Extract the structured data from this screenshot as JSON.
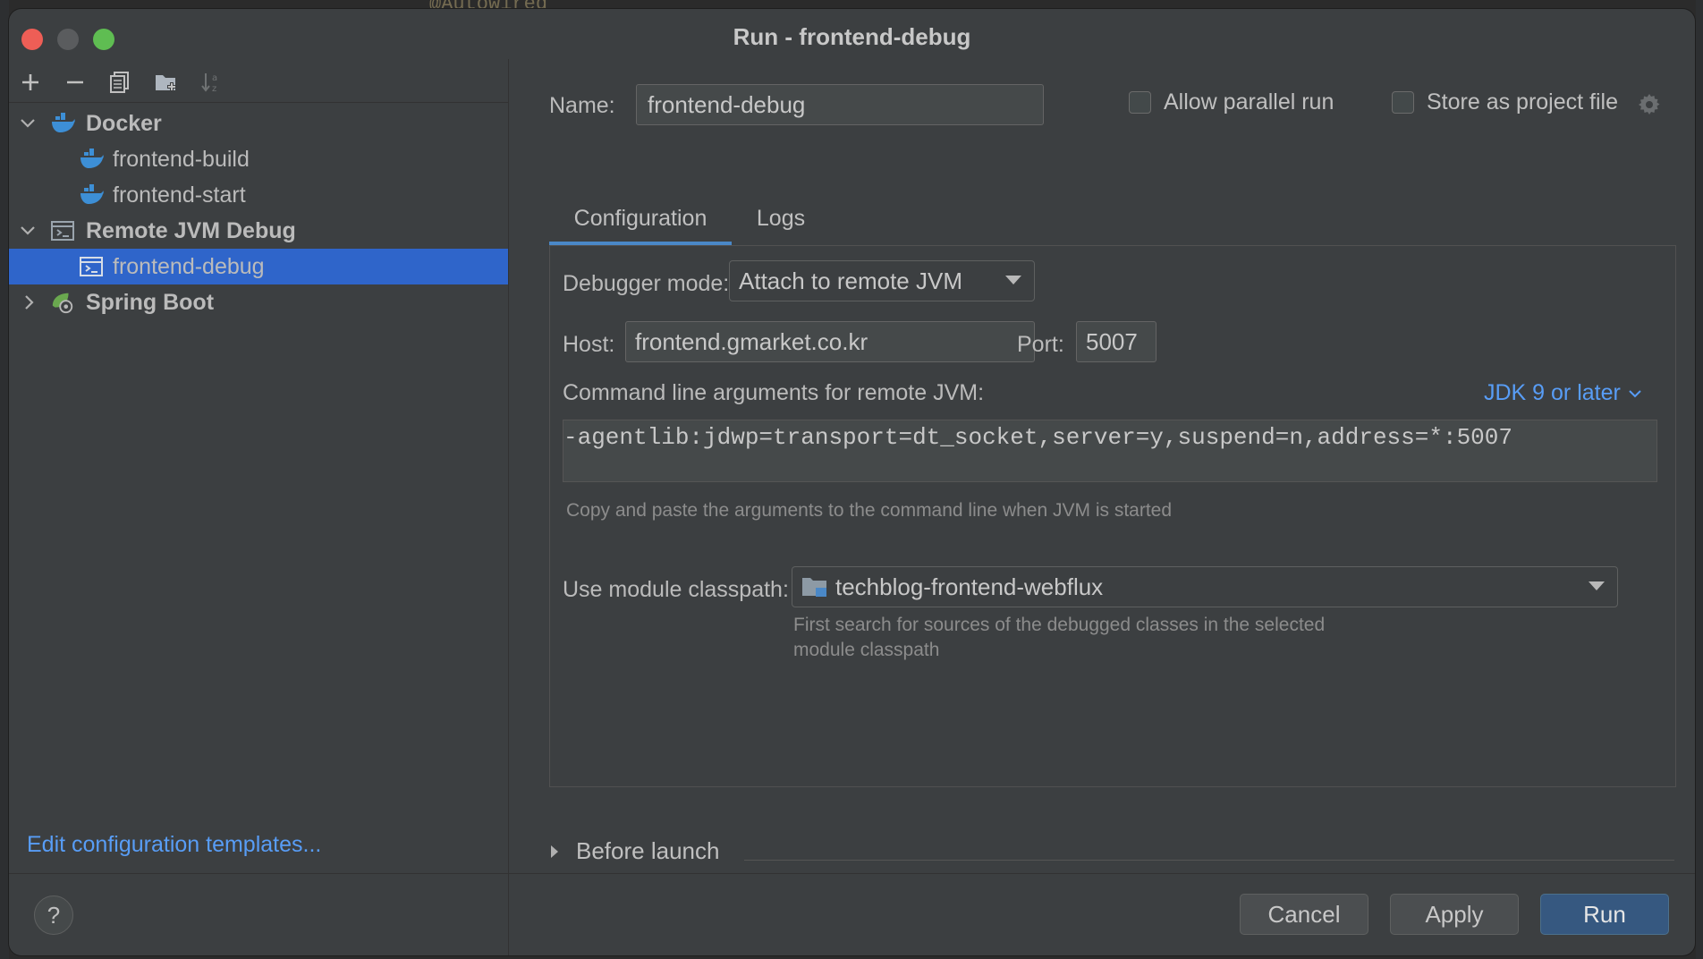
{
  "window": {
    "title": "Run - frontend-debug"
  },
  "background": {
    "code_fragment": "@Autowired"
  },
  "toolbar": {
    "icons": [
      "add-icon",
      "remove-icon",
      "copy-icon",
      "new-folder-icon",
      "sort-icon"
    ]
  },
  "tree": {
    "groups": [
      {
        "label": "Docker",
        "icon": "docker-icon",
        "expanded": true,
        "children": [
          {
            "label": "frontend-build",
            "icon": "docker-icon"
          },
          {
            "label": "frontend-start",
            "icon": "docker-icon"
          }
        ]
      },
      {
        "label": "Remote JVM Debug",
        "icon": "remote-debug-icon",
        "expanded": true,
        "children": [
          {
            "label": "frontend-debug",
            "icon": "remote-debug-icon",
            "selected": true
          }
        ]
      },
      {
        "label": "Spring Boot",
        "icon": "spring-boot-icon",
        "expanded": false,
        "children": []
      }
    ]
  },
  "edit_templates_link": "Edit configuration templates...",
  "form": {
    "name_label": "Name:",
    "name_value": "frontend-debug",
    "allow_parallel_label": "Allow parallel run",
    "allow_parallel_checked": false,
    "store_project_label": "Store as project file",
    "store_project_checked": false
  },
  "tabs": [
    {
      "label": "Configuration",
      "active": true
    },
    {
      "label": "Logs",
      "active": false
    }
  ],
  "config": {
    "debugger_mode_label": "Debugger mode:",
    "debugger_mode_value": "Attach to remote JVM",
    "host_label": "Host:",
    "host_value": "frontend.gmarket.co.kr",
    "port_label": "Port:",
    "port_value": "5007",
    "cmd_label": "Command line arguments for remote JVM:",
    "jdk_value": "JDK 9 or later",
    "cmd_value": "-agentlib:jdwp=transport=dt_socket,server=y,suspend=n,address=*:5007",
    "cmd_hint": "Copy and paste the arguments to the command line when JVM is started",
    "classpath_label": "Use module classpath:",
    "classpath_value": "techblog-frontend-webflux",
    "classpath_hint_1": "First search for sources of the debugged classes in the selected",
    "classpath_hint_2": "module classpath"
  },
  "before_launch": "Before launch",
  "footer": {
    "help": "?",
    "cancel": "Cancel",
    "apply": "Apply",
    "run": "Run"
  },
  "colors": {
    "selection": "#2f65ca",
    "link": "#589df6",
    "primary_button": "#365880"
  }
}
